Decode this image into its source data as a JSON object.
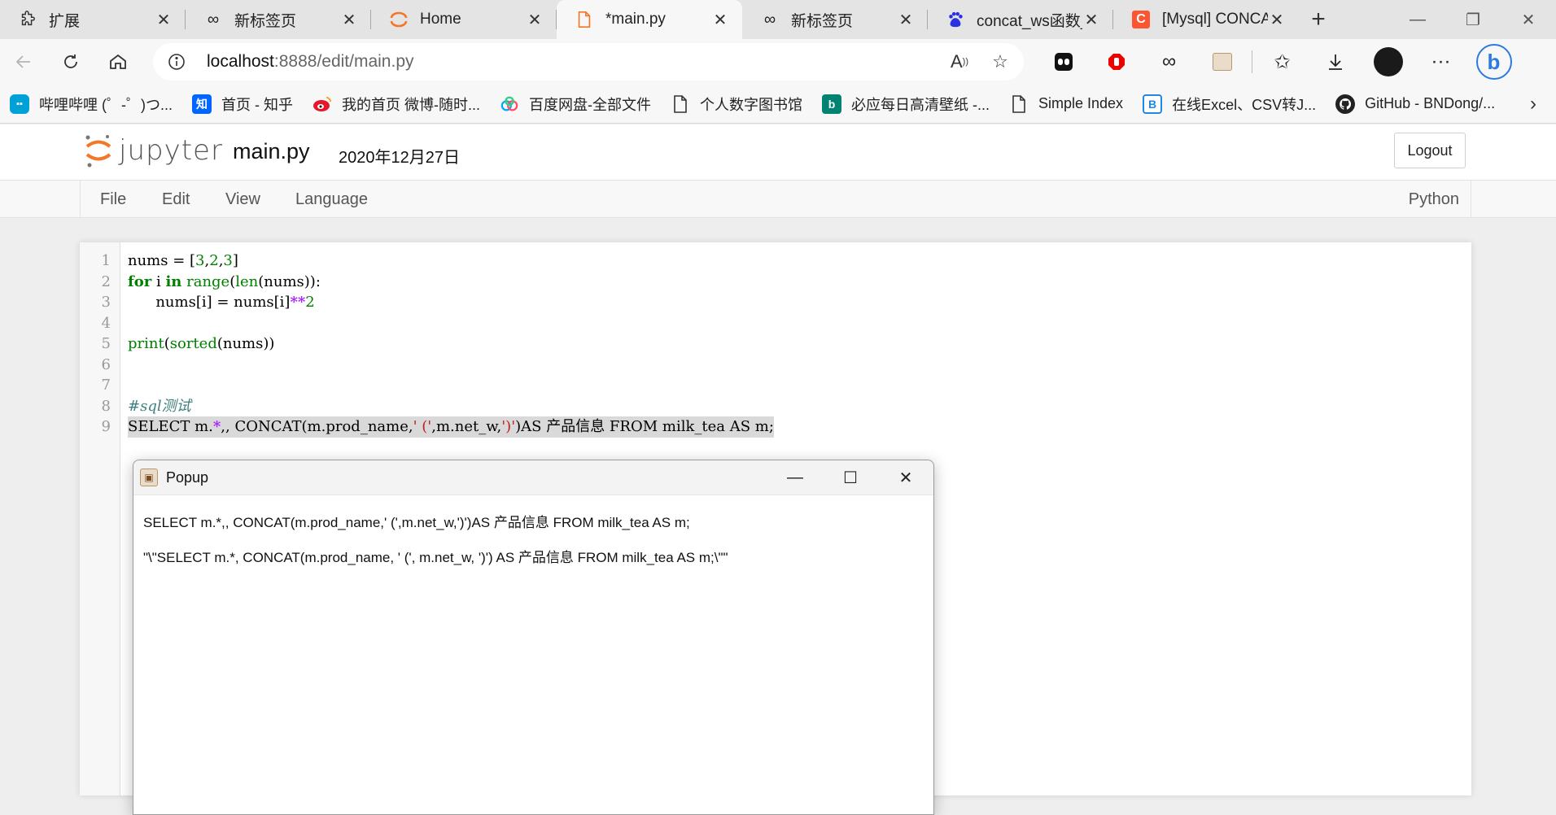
{
  "tabs": [
    {
      "label": "扩展",
      "icon": "puzzle-icon",
      "active": false
    },
    {
      "label": "新标签页",
      "icon": "infinity-icon",
      "active": false
    },
    {
      "label": "Home",
      "icon": "jupyter-logo-icon",
      "active": false
    },
    {
      "label": "*main.py",
      "icon": "file-icon",
      "active": true
    },
    {
      "label": "新标签页",
      "icon": "infinity-icon",
      "active": false
    },
    {
      "label": "concat_ws函数_百",
      "icon": "baidu-paw-icon",
      "active": false
    },
    {
      "label": "[Mysql] CONCAT",
      "icon": "csdn-icon",
      "active": false
    }
  ],
  "address": {
    "host": "localhost",
    "path": ":8888/edit/main.py"
  },
  "bookmarks": [
    {
      "label": "哔哩哔哩 (゜-゜)つ...",
      "icon": "bilibili-icon",
      "color": "#00a1d6"
    },
    {
      "label": "首页 - 知乎",
      "icon": "zhihu-icon",
      "color": "#0066ff",
      "glyph": "知"
    },
    {
      "label": "我的首页 微博-随时...",
      "icon": "weibo-icon",
      "color": "#e6162d"
    },
    {
      "label": "百度网盘-全部文件",
      "icon": "baidu-netdisk-icon",
      "color": "#06a7ff"
    },
    {
      "label": "个人数字图书馆",
      "icon": "page-icon",
      "color": "#ffffff"
    },
    {
      "label": "必应每日高清壁纸 -...",
      "icon": "bing-icon",
      "color": "#008373",
      "glyph": "b"
    },
    {
      "label": "Simple Index",
      "icon": "page-icon",
      "color": "#ffffff"
    },
    {
      "label": "在线Excel、CSV转J...",
      "icon": "bracket-b-icon",
      "color": "#1e88e5",
      "glyph": "B"
    },
    {
      "label": "GitHub - BNDong/...",
      "icon": "github-icon",
      "color": "#222222"
    }
  ],
  "jupyter": {
    "logo_text": "jupyter",
    "filename": "main.py",
    "date": "2020年12月27日",
    "logout_label": "Logout",
    "menus": [
      "File",
      "Edit",
      "View",
      "Language"
    ],
    "language": "Python"
  },
  "code_lines": [
    {
      "n": "1"
    },
    {
      "n": "2"
    },
    {
      "n": "3"
    },
    {
      "n": "4"
    },
    {
      "n": "5"
    },
    {
      "n": "6"
    },
    {
      "n": "7"
    },
    {
      "n": "8"
    },
    {
      "n": "9"
    }
  ],
  "popup": {
    "title": "Popup",
    "line1": "SELECT m.*,, CONCAT(m.prod_name,' (',m.net_w,')')AS 产品信息 FROM milk_tea AS m;",
    "line2": "\"\\\"SELECT m.*, CONCAT(m.prod_name, ' (', m.net_w, ')') AS 产品信息 FROM milk_tea AS m;\\\"\""
  },
  "colors": {
    "jupyter_orange": "#f37726",
    "selection": "#d9d9d9",
    "keyword": "#008000",
    "operator": "#aa22ff"
  }
}
